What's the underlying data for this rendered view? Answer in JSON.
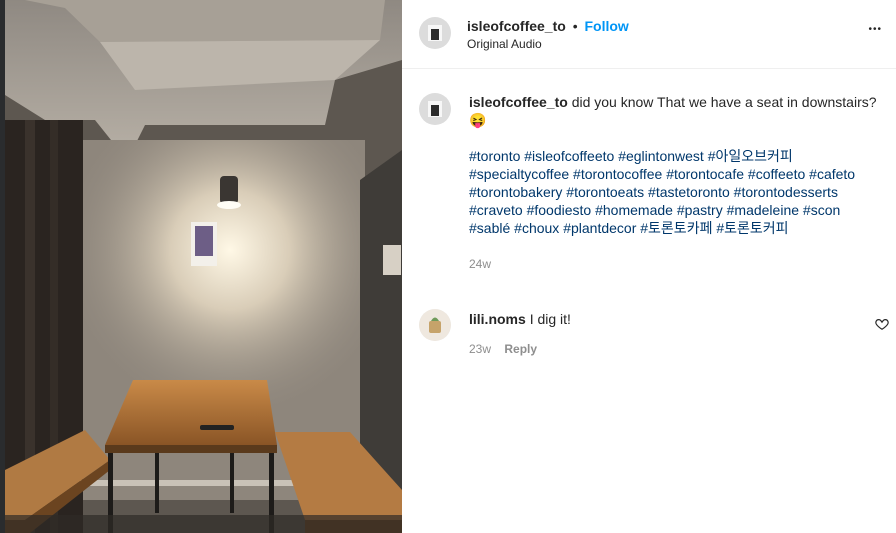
{
  "post": {
    "author": "isleofcoffee_to",
    "dot": "•",
    "follow_label": "Follow",
    "audio": "Original Audio",
    "more": "•••"
  },
  "caption": {
    "username": "isleofcoffee_to",
    "text": "did you know That we have a seat in downstairs?",
    "emoji": "😝",
    "hashtags": [
      "#toronto",
      "#isleofcoffeeto",
      "#eglintonwest",
      "#아일오브커피",
      "#specialtycoffee",
      "#torontocoffee",
      "#torontocafe",
      "#coffeeto",
      "#cafeto",
      "#torontobakery",
      "#torontoeats",
      "#tastetoronto",
      "#torontodesserts",
      "#craveto",
      "#foodiesto",
      "#homemade",
      "#pastry",
      "#madeleine",
      "#scon",
      "#sablé",
      "#choux",
      "#plantdecor",
      "#토론토카페",
      "#토론토커피"
    ],
    "time": "24w"
  },
  "comment": {
    "username": "lili.noms",
    "text": "I dig it!",
    "time": "23w",
    "reply_label": "Reply"
  }
}
